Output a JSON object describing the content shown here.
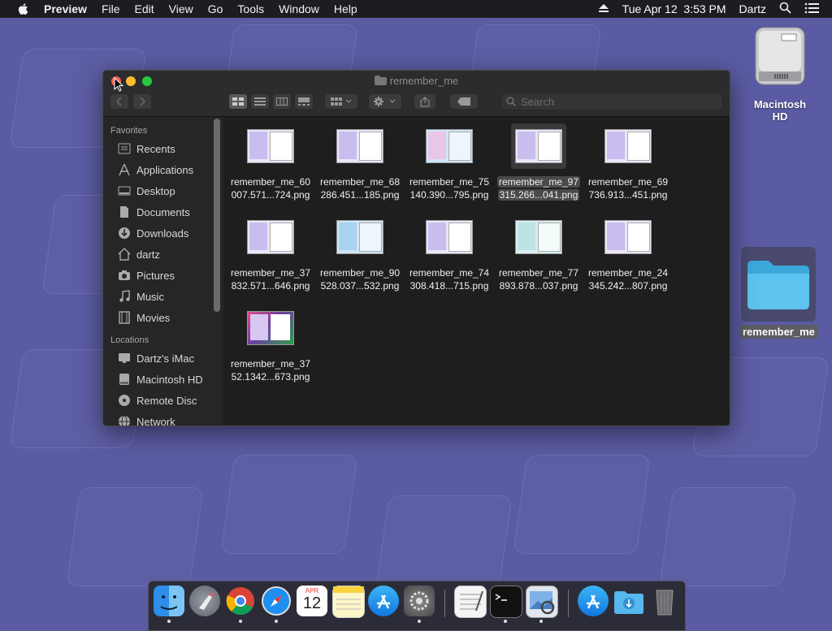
{
  "menubar": {
    "app_name": "Preview",
    "menus": [
      "File",
      "Edit",
      "View",
      "Go",
      "Tools",
      "Window",
      "Help"
    ],
    "datetime": "Tue Apr 12  3:53 PM",
    "user": "Dartz"
  },
  "desktop": {
    "hd_label": "Macintosh HD",
    "folder_label": "remember_me"
  },
  "window": {
    "title": "remember_me",
    "search_placeholder": "Search",
    "sidebar": {
      "favorites_header": "Favorites",
      "favorites": [
        {
          "label": "Recents",
          "icon": "clock-icon"
        },
        {
          "label": "Applications",
          "icon": "applications-icon"
        },
        {
          "label": "Desktop",
          "icon": "desktop-icon"
        },
        {
          "label": "Documents",
          "icon": "document-icon"
        },
        {
          "label": "Downloads",
          "icon": "download-icon"
        },
        {
          "label": "dartz",
          "icon": "home-icon"
        },
        {
          "label": "Pictures",
          "icon": "camera-icon"
        },
        {
          "label": "Music",
          "icon": "music-icon"
        },
        {
          "label": "Movies",
          "icon": "film-icon"
        }
      ],
      "locations_header": "Locations",
      "locations": [
        {
          "label": "Dartz's iMac",
          "icon": "imac-icon"
        },
        {
          "label": "Macintosh HD",
          "icon": "disk-icon"
        },
        {
          "label": "Remote Disc",
          "icon": "disc-icon"
        },
        {
          "label": "Network",
          "icon": "network-icon"
        }
      ]
    },
    "files": [
      {
        "line1": "remember_me_60",
        "line2": "007.571...724.png",
        "selected": false
      },
      {
        "line1": "remember_me_68",
        "line2": "286.451...185.png",
        "selected": false
      },
      {
        "line1": "remember_me_75",
        "line2": "140.390...795.png",
        "selected": false
      },
      {
        "line1": "remember_me_97",
        "line2": "315.266...041.png",
        "selected": true
      },
      {
        "line1": "remember_me_69",
        "line2": "736.913...451.png",
        "selected": false
      },
      {
        "line1": "remember_me_37",
        "line2": "832.571...646.png",
        "selected": false
      },
      {
        "line1": "remember_me_90",
        "line2": "528.037...532.png",
        "selected": false
      },
      {
        "line1": "remember_me_74",
        "line2": "308.418...715.png",
        "selected": false
      },
      {
        "line1": "remember_me_77",
        "line2": "893.878...037.png",
        "selected": false
      },
      {
        "line1": "remember_me_24",
        "line2": "345.242...807.png",
        "selected": false
      },
      {
        "line1": "remember_me_37",
        "line2": "52.1342...673.png",
        "selected": false
      }
    ]
  },
  "dock": {
    "calendar_month": "APR",
    "calendar_day": "12",
    "apps": [
      "finder-icon",
      "launchpad-icon",
      "chrome-icon",
      "safari-icon",
      "calendar-icon",
      "notes-icon",
      "app-store-icon",
      "system-preferences-icon",
      "textedit-icon",
      "terminal-icon",
      "preview-icon",
      "app-store-icon",
      "downloads-folder-icon",
      "trash-icon"
    ]
  },
  "colors": {
    "desktop": "#5b5ba3",
    "close": "#ff5f57",
    "minimize": "#febc2e",
    "zoom": "#28c840"
  }
}
